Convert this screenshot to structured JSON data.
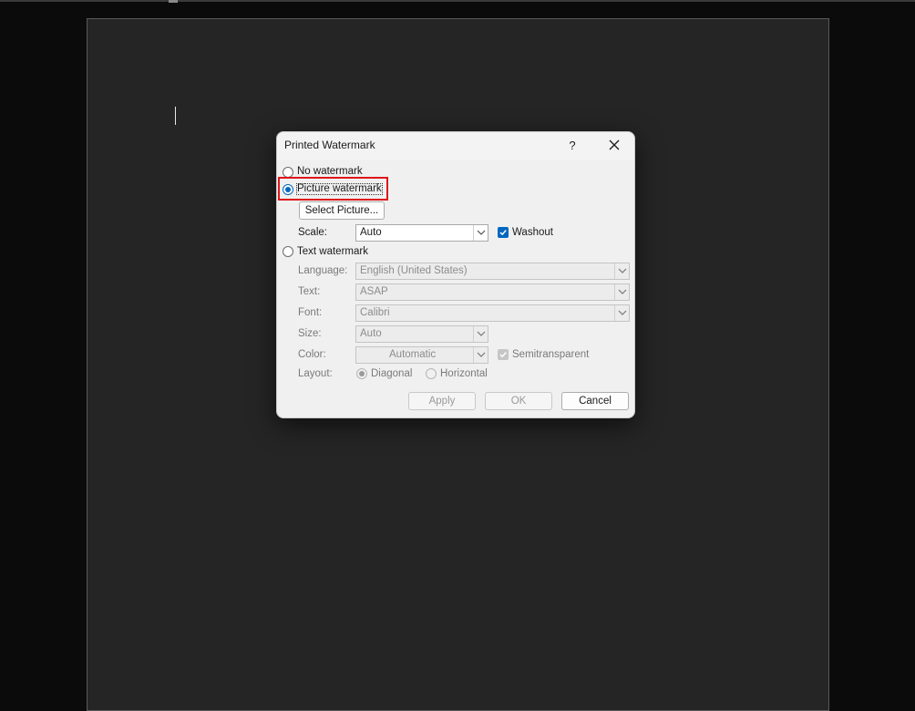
{
  "dialog": {
    "title": "Printed Watermark",
    "help_label": "?",
    "no_watermark_label": "No watermark",
    "picture_watermark_label": "Picture watermark",
    "select_picture_label": "Select Picture...",
    "scale_label": "Scale:",
    "scale_value": "Auto",
    "washout_label": "Washout",
    "washout_checked": true,
    "text_watermark_label": "Text watermark",
    "language_label": "Language:",
    "language_value": "English (United States)",
    "text_label": "Text:",
    "text_value": "ASAP",
    "font_label": "Font:",
    "font_value": "Calibri",
    "size_label": "Size:",
    "size_value": "Auto",
    "color_label": "Color:",
    "color_value": "Automatic",
    "semitransparent_label": "Semitransparent",
    "layout_label": "Layout:",
    "diagonal_label": "Diagonal",
    "horizontal_label": "Horizontal",
    "apply_label": "Apply",
    "ok_label": "OK",
    "cancel_label": "Cancel"
  },
  "colors": {
    "accent": "#0067c0",
    "highlight_border": "#e0151b",
    "document_bg": "#252525"
  }
}
